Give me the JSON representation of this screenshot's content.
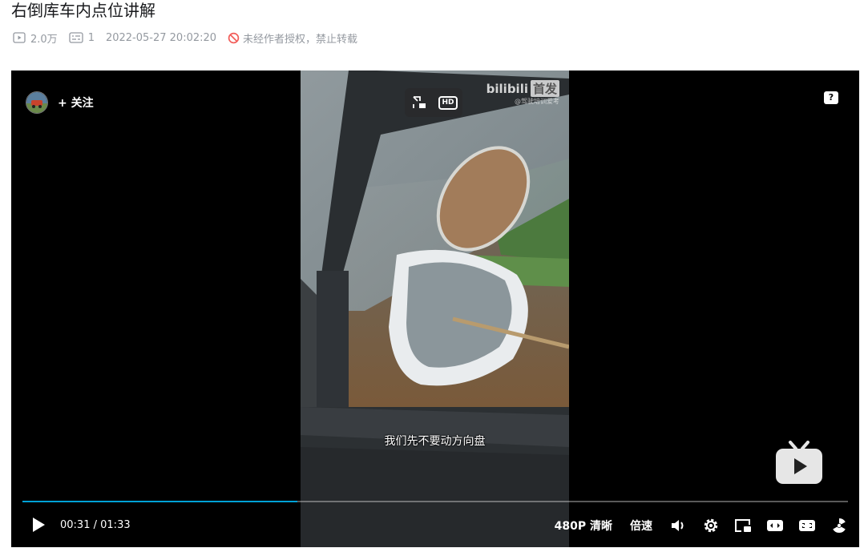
{
  "page": {
    "title": "右倒库车内点位讲解",
    "meta": {
      "views": "2.0万",
      "danmaku": "1",
      "date": "2022-05-27 20:02:20",
      "copyright": "未经作者授权，禁止转载"
    }
  },
  "player": {
    "follow_label": "+ 关注",
    "help": "?",
    "watermark_brand": "bilibili",
    "watermark_tag": "首发",
    "watermark_sub": "@驾驶培训爱考",
    "hd_label": "HD",
    "subtitle": "我们先不要动方向盘",
    "progress_fraction": 0.333,
    "time_current": "00:31",
    "time_separator": "/",
    "time_total": "01:33",
    "quality_label": "480P 清晰",
    "speed_label": "倍速",
    "colors": {
      "accent": "#00a1d6",
      "background": "#000000"
    },
    "icons": [
      "play-icon",
      "volume-icon",
      "settings-icon",
      "pip-icon",
      "widescreen-icon",
      "web-fullscreen-icon",
      "fullscreen-icon"
    ]
  }
}
